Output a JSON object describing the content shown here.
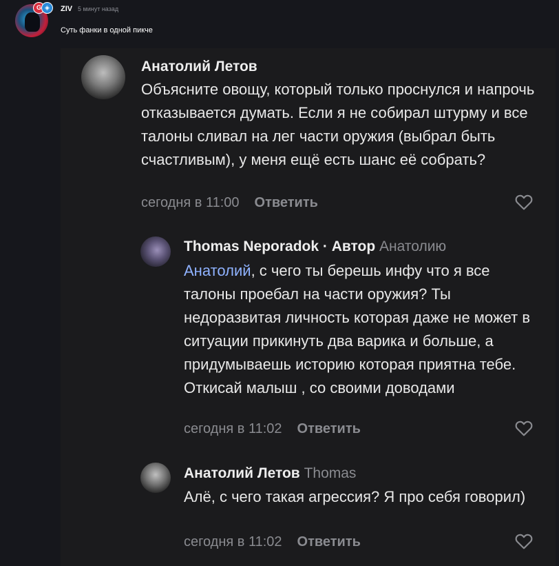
{
  "post": {
    "author": "ZIV",
    "time": "5 минут назад",
    "text": "Суть фанки в одной пикче",
    "badges": [
      "G",
      "◈"
    ]
  },
  "comments": [
    {
      "author": "Анатолий Летов",
      "text": "Объясните овощу, который только проснулся и напрочь отказывается думать. Если я не собирал штурму и все талоны сливал на лег части оружия (выбрал быть счастливым), у меня ещё есть шанс её собрать?",
      "time": "сегодня в 11:00",
      "reply_label": "Ответить"
    },
    {
      "author": "Thomas Neporadok · Автор",
      "reply_to": "Анатолию",
      "mention": "Анатолий",
      "text": ", с чего ты берешь инфу что я все талоны проебал на части оружия? Ты недоразвитая личность которая даже не может в ситуации прикинуть два варика и больше, а придумываешь историю которая приятна тебе. Откисай малыш , со своими доводами",
      "time": "сегодня в 11:02",
      "reply_label": "Ответить"
    },
    {
      "author": "Анатолий Летов",
      "reply_to": "Thomas",
      "text": "Алё, с чего такая агрессия? Я про себя говорил)",
      "time": "сегодня в 11:02",
      "reply_label": "Ответить"
    }
  ],
  "icons": {
    "like": "heart-outline-icon"
  },
  "colors": {
    "mention": "#8fb2ff",
    "background": "#16171c",
    "card": "#1b1b1d"
  }
}
